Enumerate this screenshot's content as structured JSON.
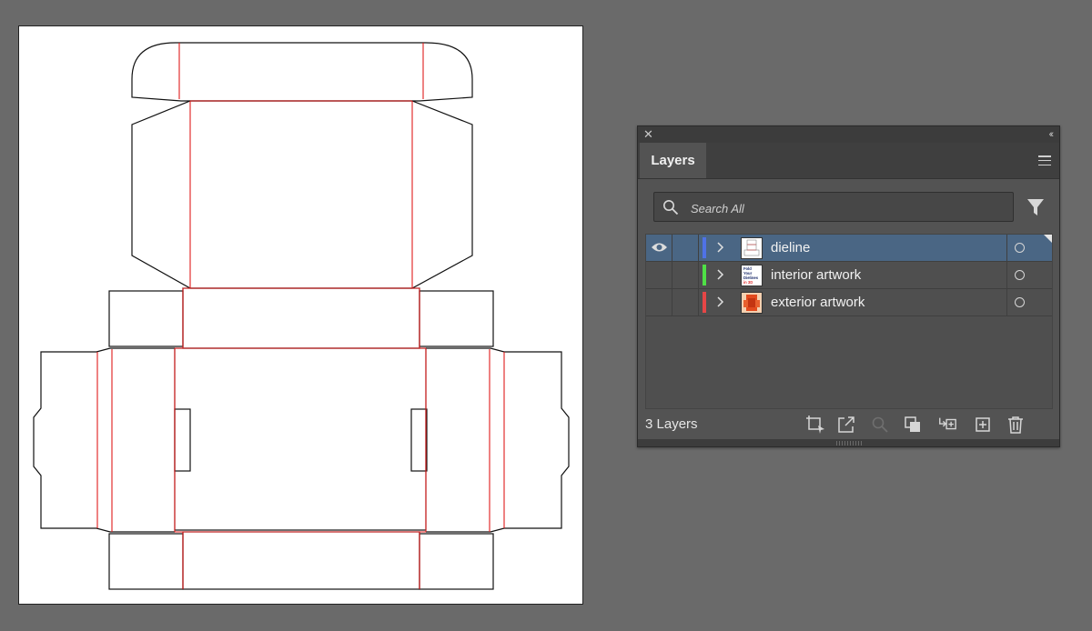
{
  "panel": {
    "close_symbol": "✕",
    "collapse_symbol": "‹‹",
    "tab_label": "Layers",
    "search_placeholder": "Search All",
    "layer_count": "3 Layers",
    "layers": [
      {
        "name": "dieline",
        "color": "#4f72e6",
        "selected": true,
        "visible": true,
        "thumb": "dieline-thumbnail"
      },
      {
        "name": "interior artwork",
        "color": "#4fe046",
        "selected": false,
        "visible": false,
        "thumb": "interior-artwork-thumbnail",
        "thumb_text": [
          "Fold",
          "Your",
          "Dielines",
          "in 3D"
        ]
      },
      {
        "name": "exterior artwork",
        "color": "#e64646",
        "selected": false,
        "visible": false,
        "thumb": "exterior-artwork-thumbnail"
      }
    ],
    "footer_icons": [
      "collect-for-export-icon",
      "export-icon",
      "locate-object-icon",
      "clipping-mask-icon",
      "create-sublayer-icon",
      "new-layer-icon",
      "delete-icon"
    ]
  },
  "colors": {
    "cut_line": "#111111",
    "fold_line": "#e01b1b",
    "selection": "#4a6684"
  }
}
